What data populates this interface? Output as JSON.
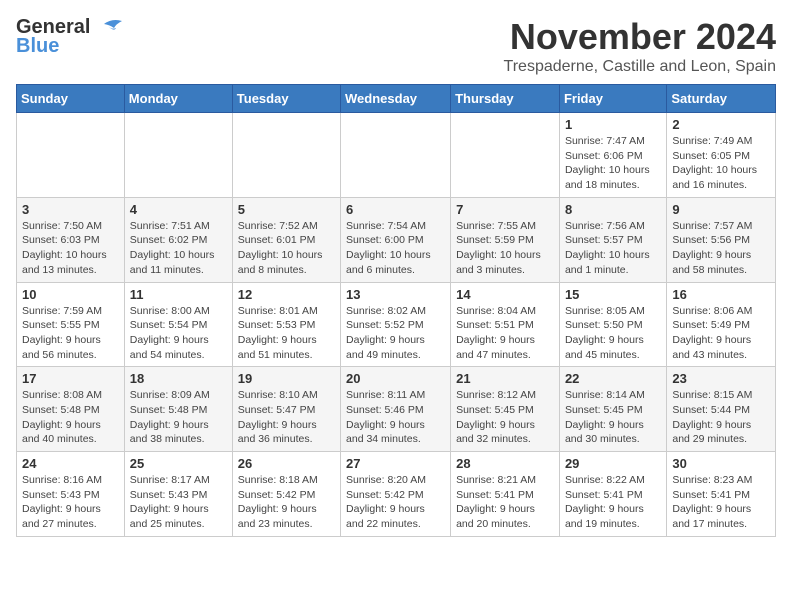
{
  "logo": {
    "general": "General",
    "blue": "Blue"
  },
  "title": "November 2024",
  "location": "Trespaderne, Castille and Leon, Spain",
  "weekdays": [
    "Sunday",
    "Monday",
    "Tuesday",
    "Wednesday",
    "Thursday",
    "Friday",
    "Saturday"
  ],
  "weeks": [
    [
      {
        "day": "",
        "info": ""
      },
      {
        "day": "",
        "info": ""
      },
      {
        "day": "",
        "info": ""
      },
      {
        "day": "",
        "info": ""
      },
      {
        "day": "",
        "info": ""
      },
      {
        "day": "1",
        "info": "Sunrise: 7:47 AM\nSunset: 6:06 PM\nDaylight: 10 hours and 18 minutes."
      },
      {
        "day": "2",
        "info": "Sunrise: 7:49 AM\nSunset: 6:05 PM\nDaylight: 10 hours and 16 minutes."
      }
    ],
    [
      {
        "day": "3",
        "info": "Sunrise: 7:50 AM\nSunset: 6:03 PM\nDaylight: 10 hours and 13 minutes."
      },
      {
        "day": "4",
        "info": "Sunrise: 7:51 AM\nSunset: 6:02 PM\nDaylight: 10 hours and 11 minutes."
      },
      {
        "day": "5",
        "info": "Sunrise: 7:52 AM\nSunset: 6:01 PM\nDaylight: 10 hours and 8 minutes."
      },
      {
        "day": "6",
        "info": "Sunrise: 7:54 AM\nSunset: 6:00 PM\nDaylight: 10 hours and 6 minutes."
      },
      {
        "day": "7",
        "info": "Sunrise: 7:55 AM\nSunset: 5:59 PM\nDaylight: 10 hours and 3 minutes."
      },
      {
        "day": "8",
        "info": "Sunrise: 7:56 AM\nSunset: 5:57 PM\nDaylight: 10 hours and 1 minute."
      },
      {
        "day": "9",
        "info": "Sunrise: 7:57 AM\nSunset: 5:56 PM\nDaylight: 9 hours and 58 minutes."
      }
    ],
    [
      {
        "day": "10",
        "info": "Sunrise: 7:59 AM\nSunset: 5:55 PM\nDaylight: 9 hours and 56 minutes."
      },
      {
        "day": "11",
        "info": "Sunrise: 8:00 AM\nSunset: 5:54 PM\nDaylight: 9 hours and 54 minutes."
      },
      {
        "day": "12",
        "info": "Sunrise: 8:01 AM\nSunset: 5:53 PM\nDaylight: 9 hours and 51 minutes."
      },
      {
        "day": "13",
        "info": "Sunrise: 8:02 AM\nSunset: 5:52 PM\nDaylight: 9 hours and 49 minutes."
      },
      {
        "day": "14",
        "info": "Sunrise: 8:04 AM\nSunset: 5:51 PM\nDaylight: 9 hours and 47 minutes."
      },
      {
        "day": "15",
        "info": "Sunrise: 8:05 AM\nSunset: 5:50 PM\nDaylight: 9 hours and 45 minutes."
      },
      {
        "day": "16",
        "info": "Sunrise: 8:06 AM\nSunset: 5:49 PM\nDaylight: 9 hours and 43 minutes."
      }
    ],
    [
      {
        "day": "17",
        "info": "Sunrise: 8:08 AM\nSunset: 5:48 PM\nDaylight: 9 hours and 40 minutes."
      },
      {
        "day": "18",
        "info": "Sunrise: 8:09 AM\nSunset: 5:48 PM\nDaylight: 9 hours and 38 minutes."
      },
      {
        "day": "19",
        "info": "Sunrise: 8:10 AM\nSunset: 5:47 PM\nDaylight: 9 hours and 36 minutes."
      },
      {
        "day": "20",
        "info": "Sunrise: 8:11 AM\nSunset: 5:46 PM\nDaylight: 9 hours and 34 minutes."
      },
      {
        "day": "21",
        "info": "Sunrise: 8:12 AM\nSunset: 5:45 PM\nDaylight: 9 hours and 32 minutes."
      },
      {
        "day": "22",
        "info": "Sunrise: 8:14 AM\nSunset: 5:45 PM\nDaylight: 9 hours and 30 minutes."
      },
      {
        "day": "23",
        "info": "Sunrise: 8:15 AM\nSunset: 5:44 PM\nDaylight: 9 hours and 29 minutes."
      }
    ],
    [
      {
        "day": "24",
        "info": "Sunrise: 8:16 AM\nSunset: 5:43 PM\nDaylight: 9 hours and 27 minutes."
      },
      {
        "day": "25",
        "info": "Sunrise: 8:17 AM\nSunset: 5:43 PM\nDaylight: 9 hours and 25 minutes."
      },
      {
        "day": "26",
        "info": "Sunrise: 8:18 AM\nSunset: 5:42 PM\nDaylight: 9 hours and 23 minutes."
      },
      {
        "day": "27",
        "info": "Sunrise: 8:20 AM\nSunset: 5:42 PM\nDaylight: 9 hours and 22 minutes."
      },
      {
        "day": "28",
        "info": "Sunrise: 8:21 AM\nSunset: 5:41 PM\nDaylight: 9 hours and 20 minutes."
      },
      {
        "day": "29",
        "info": "Sunrise: 8:22 AM\nSunset: 5:41 PM\nDaylight: 9 hours and 19 minutes."
      },
      {
        "day": "30",
        "info": "Sunrise: 8:23 AM\nSunset: 5:41 PM\nDaylight: 9 hours and 17 minutes."
      }
    ]
  ]
}
